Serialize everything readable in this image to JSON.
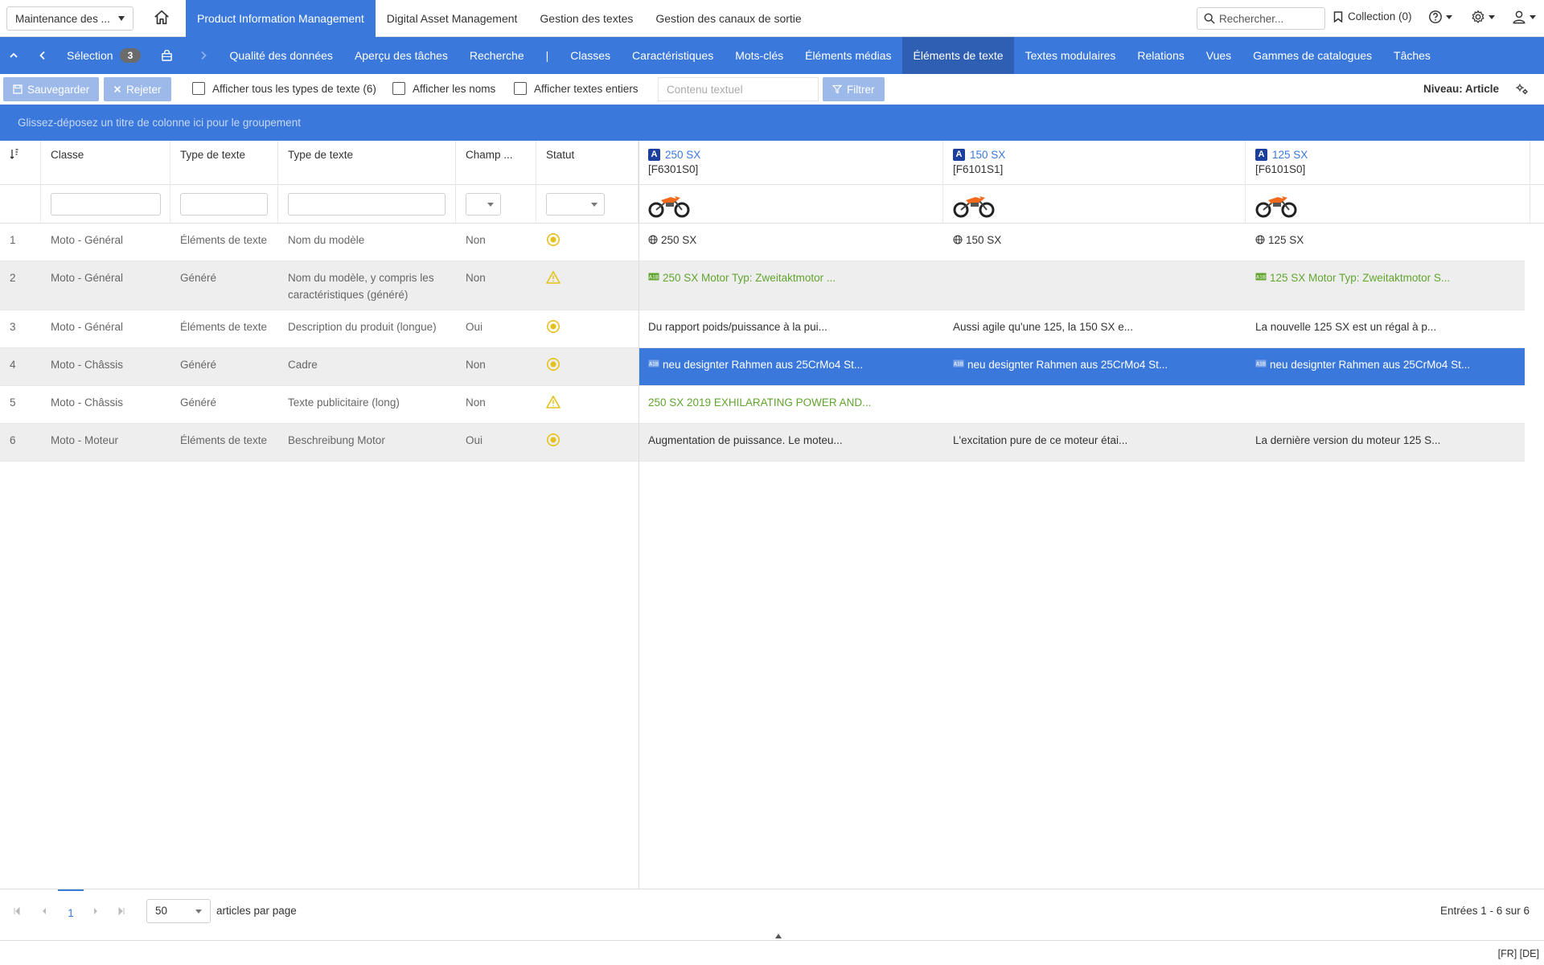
{
  "header": {
    "module_select": "Maintenance des ...",
    "nav": [
      "Product Information Management",
      "Digital Asset Management",
      "Gestion des textes",
      "Gestion des canaux de sortie"
    ],
    "search_placeholder": "Rechercher...",
    "collection": "Collection (0)"
  },
  "subnav": {
    "selection_label": "Sélection",
    "selection_count": "3",
    "separator": "|",
    "tabs": [
      "Qualité des données",
      "Aperçu des tâches",
      "Recherche",
      "|",
      "Classes",
      "Caractéristiques",
      "Mots-clés",
      "Éléments médias",
      "Éléments de texte",
      "Textes modulaires",
      "Relations",
      "Vues",
      "Gammes de catalogues",
      "Tâches"
    ],
    "active_tab": "Éléments de texte"
  },
  "toolbar": {
    "save": "Sauvegarder",
    "reject": "Rejeter",
    "chk_all_types": "Afficher tous les types de texte (6)",
    "chk_names": "Afficher les noms",
    "chk_full": "Afficher textes entiers",
    "content_placeholder": "Contenu textuel",
    "filter": "Filtrer",
    "level": "Niveau: Article"
  },
  "groupbar": "Glissez-déposez un titre de colonne ici pour le groupement",
  "grid": {
    "headers": [
      "Classe",
      "Type de texte",
      "Type de texte",
      "Champ ...",
      "Statut"
    ],
    "articles": [
      {
        "badge": "A",
        "name": "250 SX",
        "code": "[F6301S0]"
      },
      {
        "badge": "A",
        "name": "150 SX",
        "code": "[F6101S1]"
      },
      {
        "badge": "A",
        "name": "125 SX",
        "code": "[F6101S0]"
      }
    ],
    "rows": [
      {
        "num": "1",
        "classe": "Moto - Général",
        "type": "Éléments de texte",
        "texte": "Nom du modèle",
        "champ": "Non",
        "status": "ok",
        "values": [
          "250 SX",
          "150 SX",
          "125 SX"
        ],
        "kinds": [
          "globe",
          "globe",
          "globe"
        ]
      },
      {
        "num": "2",
        "classe": "Moto - Général",
        "type": "Généré",
        "texte": "Nom du modèle, y compris les caractéristiques (généré)",
        "champ": "Non",
        "status": "warn",
        "values": [
          "250 SX Motor Typ: Zweitaktmotor ...",
          "",
          "125 SX Motor Typ: Zweitaktmotor S..."
        ],
        "kinds": [
          "gen-green",
          "none",
          "gen-green"
        ]
      },
      {
        "num": "3",
        "classe": "Moto - Général",
        "type": "Éléments de texte",
        "texte": "Description du produit (longue)",
        "champ": "Oui",
        "status": "ok",
        "values": [
          "Du rapport poids/puissance à la pui...",
          "Aussi agile qu'une 125, la 150 SX e...",
          "La nouvelle 125 SX est un régal à p..."
        ],
        "kinds": [
          "plain",
          "plain",
          "plain"
        ]
      },
      {
        "num": "4",
        "classe": "Moto - Châssis",
        "type": "Généré",
        "texte": "Cadre",
        "champ": "Non",
        "status": "ok",
        "values": [
          "neu designter Rahmen aus 25CrMo4 St...",
          "neu designter Rahmen aus 25CrMo4 St...",
          "neu designter Rahmen aus 25CrMo4 St..."
        ],
        "kinds": [
          "gen-sel",
          "gen-sel",
          "gen-sel"
        ]
      },
      {
        "num": "5",
        "classe": "Moto - Châssis",
        "type": "Généré",
        "texte": "Texte publicitaire (long)",
        "champ": "Non",
        "status": "warn",
        "values": [
          "250 SX 2019 EXHILARATING POWER AND...",
          "",
          ""
        ],
        "kinds": [
          "green",
          "none",
          "none"
        ]
      },
      {
        "num": "6",
        "classe": "Moto - Moteur",
        "type": "Éléments de texte",
        "texte": "Beschreibung Motor",
        "champ": "Oui",
        "status": "ok",
        "values": [
          "Augmentation de puissance. Le moteu...",
          "L'excitation pure de ce moteur étai...",
          "La dernière version du moteur 125 S..."
        ],
        "kinds": [
          "plain",
          "plain",
          "plain"
        ]
      }
    ]
  },
  "pager": {
    "page": "1",
    "page_size": "50",
    "per_page": "articles par page",
    "entries": "Entrées 1 - 6 sur 6"
  },
  "statusbar": {
    "lang": "[FR] [DE]"
  },
  "colors": {
    "accent": "#3a78dc",
    "accent_dark": "#2f5fb3",
    "green": "#62a52e",
    "warn": "#e5c11f"
  }
}
